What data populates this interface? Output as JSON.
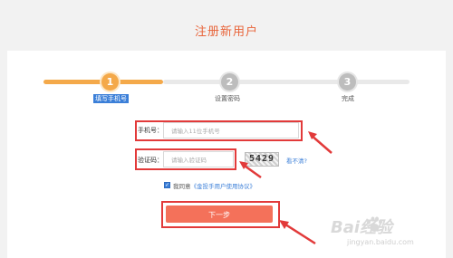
{
  "page": {
    "title": "注册新用户"
  },
  "steps": [
    {
      "number": "1",
      "label": "填写手机号",
      "active": true
    },
    {
      "number": "2",
      "label": "设置密码",
      "active": false
    },
    {
      "number": "3",
      "label": "完成",
      "active": false
    }
  ],
  "form": {
    "phone_label": "手机号：",
    "phone_placeholder": "请输入11位手机号",
    "code_label": "验证码：",
    "code_placeholder": "请输入验证码",
    "captcha_text": "5429",
    "refresh_link": "看不清?",
    "agree_prefix": "我同意",
    "agree_link": "《金投手用户使用协议》",
    "agree_checked": true,
    "next_button": "下一步"
  },
  "watermark": {
    "brand": "Bai经验",
    "url": "jingyan.baidu.com"
  },
  "colors": {
    "accent": "#e8643a",
    "progress": "#f4a94a",
    "button": "#f4715a",
    "annotation": "#e23a3a",
    "link": "#3b7fd8"
  }
}
